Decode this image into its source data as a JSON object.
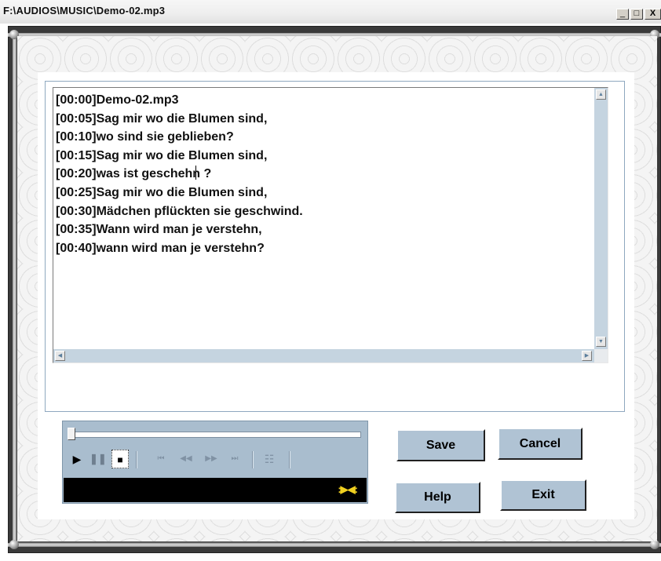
{
  "window": {
    "title": "F:\\AUDIOS\\MUSIC\\Demo-02.mp3",
    "controls": {
      "minimize": "_",
      "maximize": "□",
      "close": "X"
    }
  },
  "editor": {
    "lines": [
      "[00:00]Demo-02.mp3",
      "[00:05]Sag mir wo die Blumen sind,",
      "[00:10]wo sind sie geblieben?",
      "[00:15]Sag mir wo die Blumen sind,",
      "[00:20]was ist geschehn ?",
      "[00:25]Sag mir wo die Blumen sind,",
      "[00:30]Mädchen pflückten sie geschwind.",
      "[00:35]Wann wird man je verstehn,",
      "[00:40]wann wird man je verstehn?"
    ]
  },
  "player": {
    "seek_position": 0,
    "buttons": [
      "play-icon",
      "pause-icon",
      "stop-icon",
      "skip-back-icon",
      "rewind-icon",
      "fast-forward-icon",
      "skip-forward-icon",
      "playlist-icon"
    ]
  },
  "actions": {
    "save_label": "Save",
    "cancel_label": "Cancel",
    "help_label": "Help",
    "exit_label": "Exit"
  },
  "colors": {
    "panel_accent": "#b0c3d4",
    "player_bg": "#a9bdce",
    "status_bg": "#000000",
    "status_icon": "#f0d020"
  }
}
